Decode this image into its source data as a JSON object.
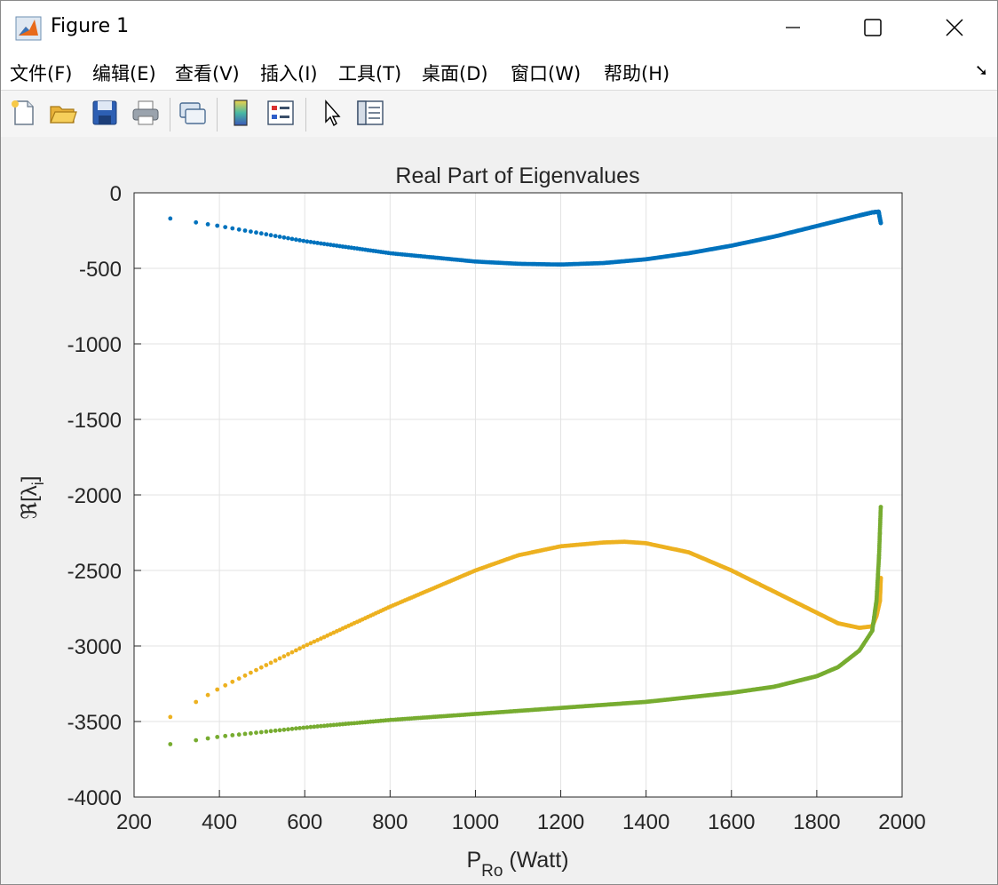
{
  "window": {
    "title": "Figure 1"
  },
  "menu": [
    "文件(F)",
    "编辑(E)",
    "查看(V)",
    "插入(I)",
    "工具(T)",
    "桌面(D)",
    "窗口(W)",
    "帮助(H)"
  ],
  "toolbar": [
    "new-figure-icon",
    "open-file-icon",
    "save-icon",
    "print-icon",
    "link-icon",
    "colorbar-icon",
    "legend-icon",
    "edit-plot-icon",
    "property-inspector-icon"
  ],
  "chart_data": {
    "type": "scatter",
    "title": "Real Part of Eigenvalues",
    "xlabel": "P",
    "xlabel_sub": "Ro",
    "xlabel_suffix": " (Watt)",
    "ylabel": "ℜ[λ",
    "ylabel_sub": "i",
    "ylabel_suffix": "]",
    "xlim": [
      200,
      2000
    ],
    "ylim": [
      -4000,
      0
    ],
    "xticks": [
      200,
      400,
      600,
      800,
      1000,
      1200,
      1400,
      1600,
      1800,
      2000
    ],
    "yticks": [
      0,
      -500,
      -1000,
      -1500,
      -2000,
      -2500,
      -3000,
      -3500,
      -4000
    ],
    "grid": true,
    "series": [
      {
        "color": "#0072BD",
        "x": [
          285,
          400,
          600,
          800,
          1000,
          1100,
          1200,
          1300,
          1400,
          1500,
          1600,
          1700,
          1800,
          1900,
          1930,
          1945,
          1950
        ],
        "y": [
          -170,
          -220,
          -320,
          -400,
          -455,
          -470,
          -475,
          -465,
          -440,
          -400,
          -350,
          -290,
          -220,
          -150,
          -130,
          -125,
          -200
        ]
      },
      {
        "color": "#EDB120",
        "x": [
          285,
          400,
          600,
          800,
          1000,
          1100,
          1200,
          1300,
          1350,
          1400,
          1500,
          1600,
          1700,
          1800,
          1850,
          1900,
          1930,
          1940,
          1948,
          1950
        ],
        "y": [
          -3470,
          -3280,
          -3000,
          -2740,
          -2500,
          -2400,
          -2340,
          -2315,
          -2310,
          -2320,
          -2380,
          -2500,
          -2640,
          -2780,
          -2850,
          -2880,
          -2870,
          -2800,
          -2700,
          -2550
        ]
      },
      {
        "color": "#77AC30",
        "x": [
          285,
          400,
          600,
          800,
          1000,
          1200,
          1400,
          1600,
          1700,
          1800,
          1850,
          1900,
          1930,
          1940,
          1946,
          1950
        ],
        "y": [
          -3650,
          -3600,
          -3540,
          -3490,
          -3450,
          -3410,
          -3370,
          -3310,
          -3270,
          -3200,
          -3140,
          -3030,
          -2900,
          -2700,
          -2400,
          -2080
        ]
      }
    ]
  }
}
